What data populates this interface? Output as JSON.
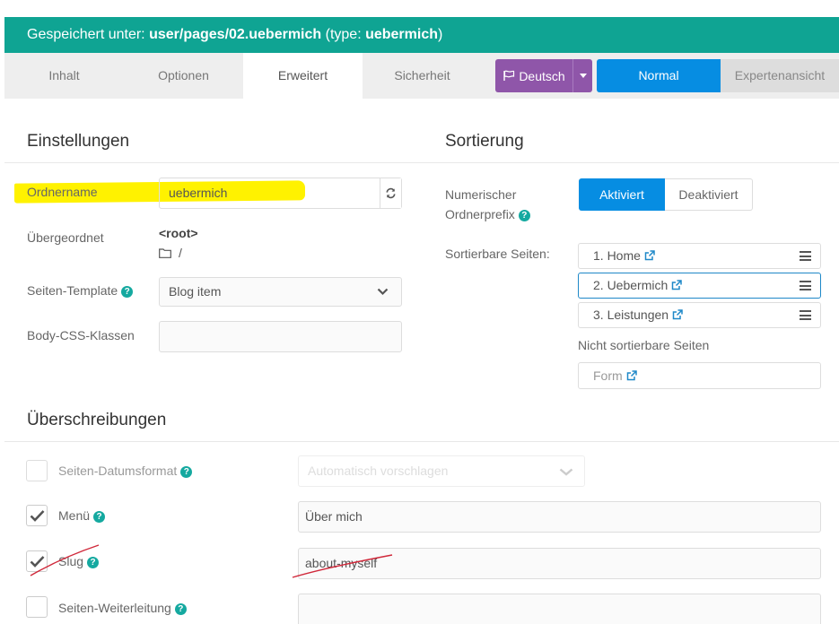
{
  "banner": {
    "prefix": "Gespeichert unter: ",
    "path": "user/pages/02.uebermich",
    "mid": " (type: ",
    "type": "uebermich",
    "suffix": ")"
  },
  "tabs": [
    {
      "label": "Inhalt"
    },
    {
      "label": "Optionen"
    },
    {
      "label": "Erweitert"
    },
    {
      "label": "Sicherheit"
    }
  ],
  "language_button": {
    "label": "Deutsch"
  },
  "mode": {
    "normal": "Normal",
    "expert": "Expertenansicht"
  },
  "settings": {
    "heading": "Einstellungen",
    "folder_label": "Ordnername",
    "folder_value": "uebermich",
    "parent_label": "Übergeordnet",
    "parent_value": "<root>",
    "parent_path": "/",
    "template_label": "Seiten-Template",
    "template_value": "Blog item",
    "css_label": "Body-CSS-Klassen",
    "css_value": ""
  },
  "sorting": {
    "heading": "Sortierung",
    "prefix_label_line1": "Numerischer",
    "prefix_label_line2": "Ordnerprefix",
    "toggle_on": "Aktiviert",
    "toggle_off": "Deaktiviert",
    "sortable_label": "Sortierbare Seiten:",
    "sortable_pages": [
      "1. Home",
      "2. Uebermich",
      "3. Leistungen"
    ],
    "non_sortable_label": "Nicht sortierbare Seiten",
    "non_sortable_pages": [
      "Form"
    ]
  },
  "overrides": {
    "heading": "Überschreibungen",
    "date_format_label": "Seiten-Datumsformat",
    "date_format_placeholder": "Automatisch vorschlagen",
    "menu_label": "Menü",
    "menu_value": "Über mich",
    "slug_label": "Slug",
    "slug_value": "about-myself",
    "redirect_label": "Seiten-Weiterleitung",
    "redirect_value": ""
  },
  "colors": {
    "banner": "#0fa493",
    "language_button": "#8f56a9",
    "primary": "#068de2",
    "highlight": "#fff200",
    "annotation": "#d0283a"
  }
}
